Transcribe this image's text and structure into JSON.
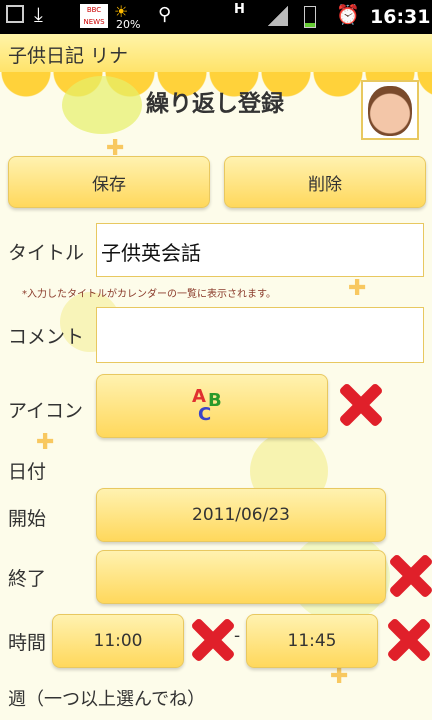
{
  "status": {
    "time": "16:31",
    "battery_percent": "20%",
    "news_label": "BBC NEWS",
    "network": "H"
  },
  "app": {
    "title": "子供日記 リナ"
  },
  "page": {
    "title": "繰り返し登録"
  },
  "actions": {
    "save_label": "保存",
    "delete_label": "削除"
  },
  "form": {
    "title_label": "タイトル",
    "title_value": "子供英会話",
    "title_note": "*入力したタイトルがカレンダーの一覧に表示されます。",
    "comment_label": "コメント",
    "comment_value": "",
    "icon_label": "アイコン",
    "icon_letters": [
      "A",
      "B",
      "C"
    ],
    "date_label": "日付",
    "start_label": "開始",
    "start_value": "2011/06/23",
    "end_label": "終了",
    "end_value": "",
    "time_label": "時間",
    "time_start": "11:00",
    "time_sep": "-",
    "time_end": "11:45",
    "week_label": "週（一つ以上選んでね）"
  },
  "colors": {
    "accent": "#ffd85c",
    "delete": "#e0202a",
    "bar": "#ffe36a"
  }
}
